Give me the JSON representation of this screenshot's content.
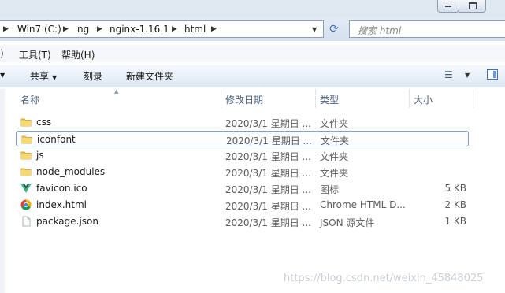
{
  "address": {
    "crumbs": [
      "Win7 (C:)",
      "ng",
      "nginx-1.16.1",
      "html"
    ],
    "separator": "▶",
    "dropdown_icon": "chevron-down-icon",
    "refresh_icon": "refresh-icon"
  },
  "search": {
    "placeholder": "搜索 html"
  },
  "menu": {
    "items": [
      ")",
      "工具(T)",
      "帮助(H)"
    ]
  },
  "toolbar": {
    "share_label": "共享",
    "burn_label": "刻录",
    "new_folder_label": "新建文件夹",
    "dropdown": "▼"
  },
  "columns": {
    "name": "名称",
    "date": "修改日期",
    "type": "类型",
    "size": "大小"
  },
  "files": [
    {
      "name": "css",
      "date": "2020/3/1 星期日 ...",
      "type": "文件夹",
      "size": "",
      "icon": "folder-icon",
      "selected": false
    },
    {
      "name": "iconfont",
      "date": "2020/3/1 星期日 ...",
      "type": "文件夹",
      "size": "",
      "icon": "folder-icon",
      "selected": true
    },
    {
      "name": "js",
      "date": "2020/3/1 星期日 ...",
      "type": "文件夹",
      "size": "",
      "icon": "folder-icon",
      "selected": false
    },
    {
      "name": "node_modules",
      "date": "2020/3/1 星期日 ...",
      "type": "文件夹",
      "size": "",
      "icon": "folder-icon",
      "selected": false
    },
    {
      "name": "favicon.ico",
      "date": "2020/3/1 星期日 ...",
      "type": "图标",
      "size": "5 KB",
      "icon": "vue-logo-icon",
      "selected": false
    },
    {
      "name": "index.html",
      "date": "2020/3/1 星期日 ...",
      "type": "Chrome HTML D...",
      "size": "2 KB",
      "icon": "chrome-icon",
      "selected": false
    },
    {
      "name": "package.json",
      "date": "2020/3/1 星期日 ...",
      "type": "JSON 源文件",
      "size": "1 KB",
      "icon": "file-icon",
      "selected": false
    }
  ],
  "watermark": "https://blog.csdn.net/weixin_45848025",
  "colors": {
    "folder": "#f2c94c",
    "vue_green": "#41b883",
    "vue_dark": "#35495e",
    "selection_border": "#7da2ce"
  }
}
